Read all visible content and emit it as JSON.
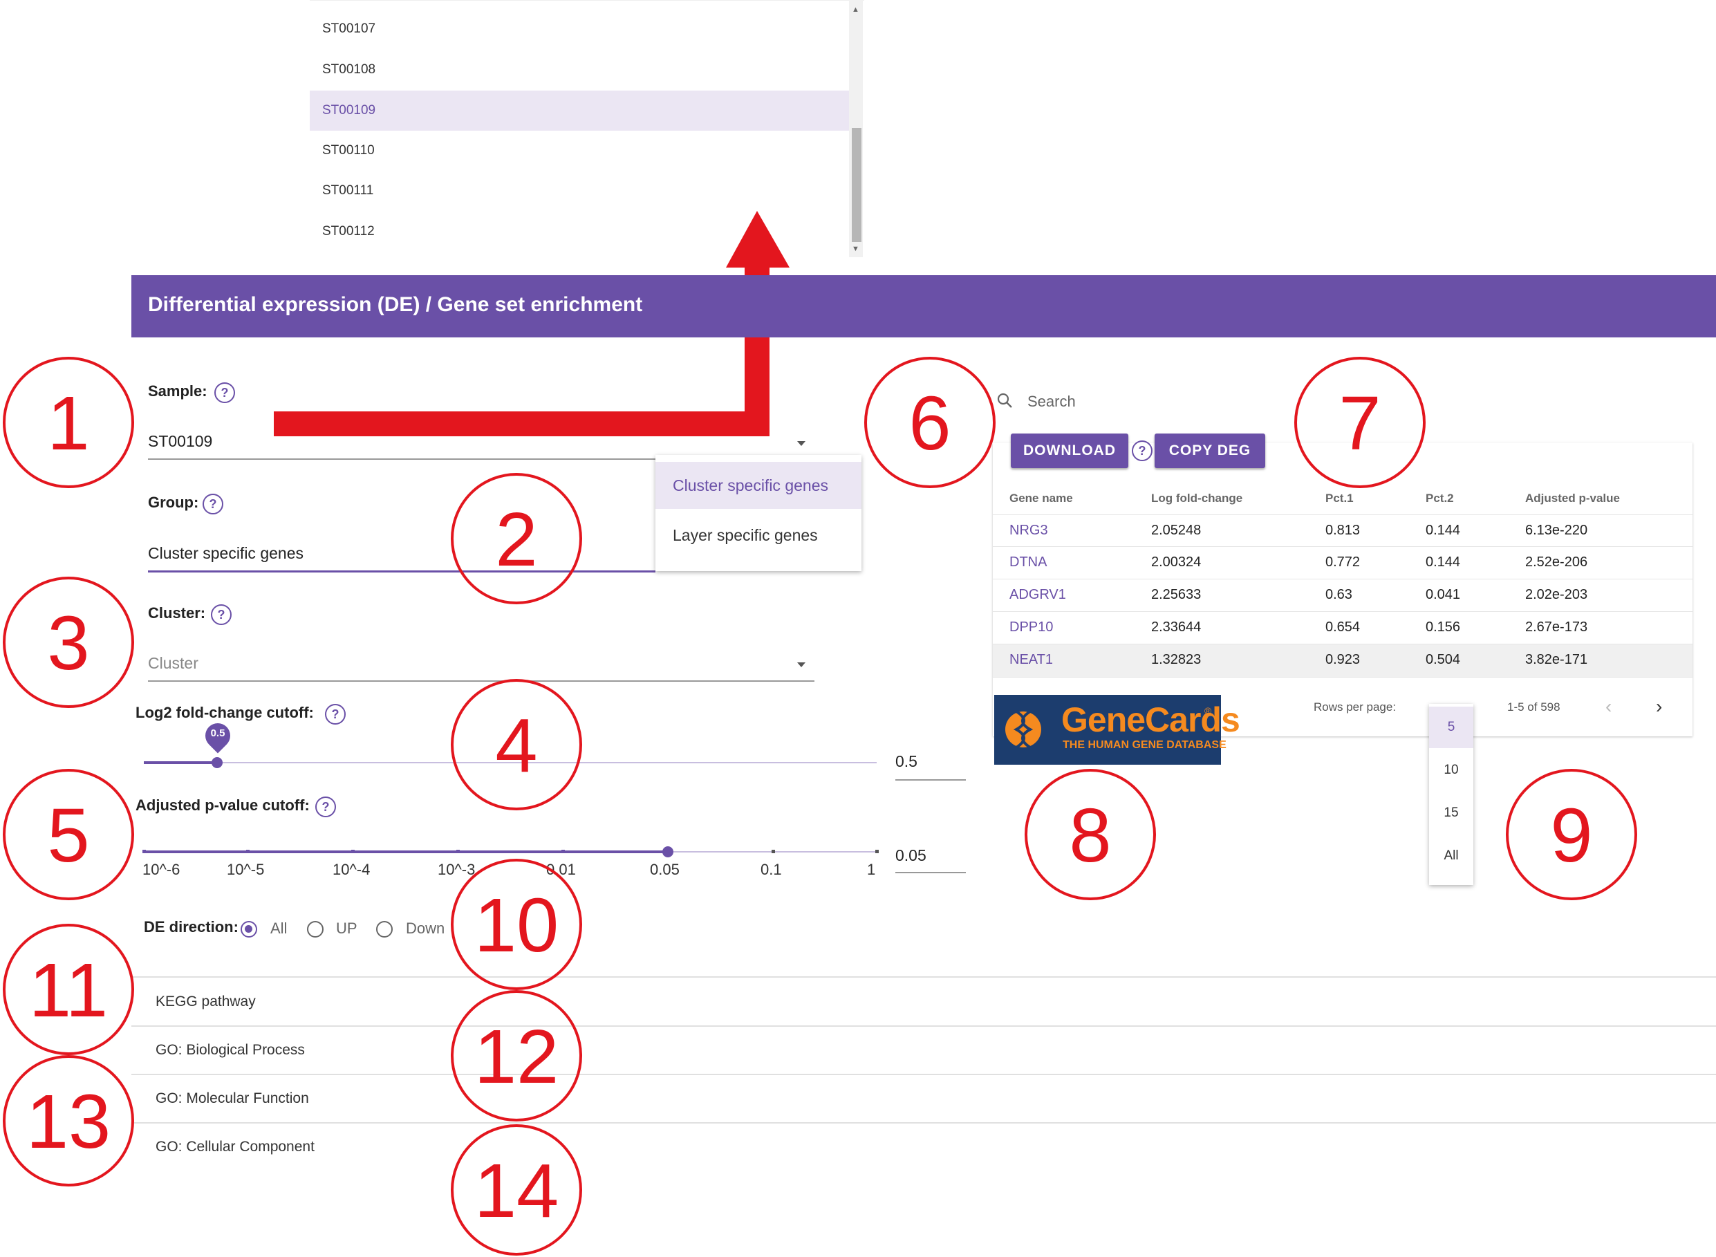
{
  "sample_list": {
    "items": [
      {
        "label": "ST00107",
        "selected": false
      },
      {
        "label": "ST00108",
        "selected": false
      },
      {
        "label": "ST00109",
        "selected": true
      },
      {
        "label": "ST00110",
        "selected": false
      },
      {
        "label": "ST00111",
        "selected": false
      },
      {
        "label": "ST00112",
        "selected": false
      }
    ]
  },
  "header": {
    "title": "Differential expression (DE) / Gene set enrichment"
  },
  "sample": {
    "label": "Sample:",
    "value": "ST00109",
    "help": "?"
  },
  "group": {
    "label": "Group:",
    "value": "Cluster specific genes",
    "help": "?",
    "options": [
      {
        "label": "Cluster specific genes",
        "selected": true
      },
      {
        "label": "Layer specific genes",
        "selected": false
      }
    ]
  },
  "cluster": {
    "label": "Cluster:",
    "placeholder": "Cluster",
    "help": "?"
  },
  "fc_cutoff": {
    "label": "Log2 fold-change cutoff:",
    "value": "0.5",
    "bubble": "0.5",
    "help": "?",
    "level": 0.5
  },
  "pval_cutoff": {
    "label": "Adjusted p-value cutoff:",
    "value": "0.05",
    "help": "?",
    "ticks": [
      "10^-6",
      "10^-5",
      "10^-4",
      "10^-3",
      "0.01",
      "0.05",
      "0.1",
      "1"
    ],
    "selected": "0.05"
  },
  "de_direction": {
    "label": "DE direction:",
    "options": [
      {
        "label": "All",
        "selected": true
      },
      {
        "label": "UP",
        "selected": false
      },
      {
        "label": "Down",
        "selected": false
      }
    ]
  },
  "accordion": [
    "KEGG pathway",
    "GO: Biological Process",
    "GO: Molecular Function",
    "GO: Cellular Component"
  ],
  "search": {
    "placeholder": "Search",
    "icon": "search-icon"
  },
  "buttons": {
    "download": "DOWNLOAD",
    "copy_deg": "COPY DEG",
    "help": "?"
  },
  "table": {
    "columns": [
      "Gene name",
      "Log fold-change",
      "Pct.1",
      "Pct.2",
      "Adjusted p-value"
    ],
    "rows": [
      [
        "NRG3",
        "2.05248",
        "0.813",
        "0.144",
        "6.13e-220"
      ],
      [
        "DTNA",
        "2.00324",
        "0.772",
        "0.144",
        "2.52e-206"
      ],
      [
        "ADGRV1",
        "2.25633",
        "0.63",
        "0.041",
        "2.02e-203"
      ],
      [
        "DPP10",
        "2.33644",
        "0.654",
        "0.156",
        "2.67e-173"
      ],
      [
        "NEAT1",
        "1.32823",
        "0.923",
        "0.504",
        "3.82e-171"
      ]
    ],
    "rows_per_page_label": "Rows per page:",
    "range": "1-5 of 598",
    "rpp_options": [
      {
        "label": "5",
        "selected": true
      },
      {
        "label": "10",
        "selected": false
      },
      {
        "label": "15",
        "selected": false
      },
      {
        "label": "All",
        "selected": false
      }
    ]
  },
  "genecards": {
    "name": "GeneCards",
    "subtitle": "THE HUMAN GENE DATABASE",
    "reg": "®"
  },
  "annotations": [
    "1",
    "2",
    "3",
    "4",
    "5",
    "6",
    "7",
    "8",
    "9",
    "10",
    "11",
    "12",
    "13",
    "14"
  ],
  "colors": {
    "accent": "#6a50a7",
    "annotation": "#e3161e",
    "genecards_bg": "#1c3d6e",
    "genecards_fg": "#f58a1f"
  }
}
